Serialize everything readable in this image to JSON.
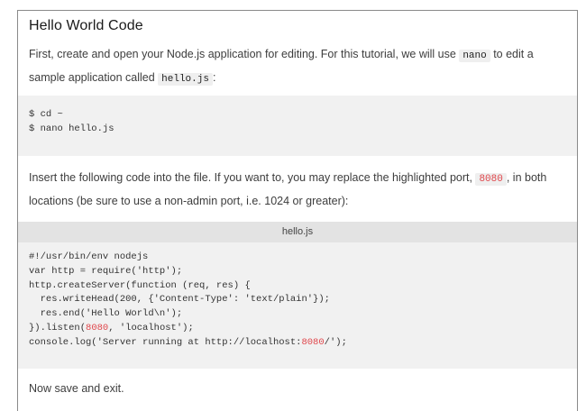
{
  "heading": "Hello World Code",
  "intro": {
    "text_before": "First, create and open your Node.js application for editing. For this tutorial, we will use ",
    "code1": "nano",
    "text_middle": " to edit a sample application called ",
    "code2": "hello.js",
    "text_after": ":"
  },
  "shell_block": {
    "lines": [
      "$ cd ~",
      "$ nano hello.js"
    ]
  },
  "insert_para": {
    "text_before": "Insert the following code into the file. If you want to, you may replace the highlighted port, ",
    "port": "8080",
    "text_after": ", in both locations (be sure to use a non-admin port, i.e. 1024 or greater):"
  },
  "code_block": {
    "filename": "hello.js",
    "lines": [
      {
        "pre": "#!/usr/bin/env nodejs",
        "hl": "",
        "post": ""
      },
      {
        "pre": "var http = require('http');",
        "hl": "",
        "post": ""
      },
      {
        "pre": "http.createServer(function (req, res) {",
        "hl": "",
        "post": ""
      },
      {
        "pre": "  res.writeHead(200, {'Content-Type': 'text/plain'});",
        "hl": "",
        "post": ""
      },
      {
        "pre": "  res.end('Hello World\\n');",
        "hl": "",
        "post": ""
      },
      {
        "pre": "}).listen(",
        "hl": "8080",
        "post": ", 'localhost');"
      },
      {
        "pre": "console.log('Server running at http://localhost:",
        "hl": "8080",
        "post": "/');"
      }
    ]
  },
  "closing": "Now save and exit.",
  "colors": {
    "highlight": "#e0474c",
    "code_bg": "#f1f1f1",
    "label_bg": "#e3e3e3"
  }
}
